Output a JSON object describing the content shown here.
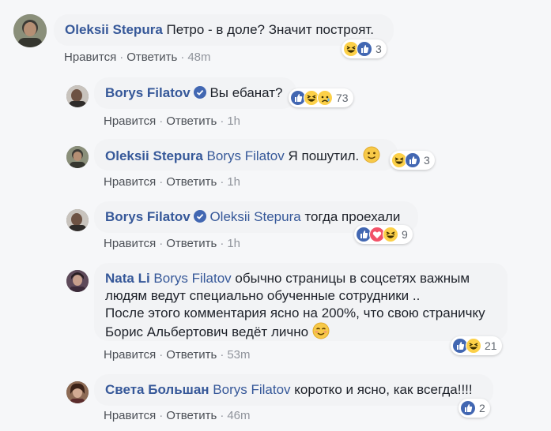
{
  "actions": {
    "like": "Нравится",
    "reply": "Ответить",
    "separator": "·"
  },
  "comments": [
    {
      "author": "Oleksii Stepura",
      "text": "Петро - в доле? Значит построят.",
      "time": "48m",
      "reactions": [
        "haha",
        "like"
      ],
      "count": "3"
    },
    {
      "author": "Borys Filatov",
      "verified": true,
      "text": "Вы ебанат?",
      "time": "1h",
      "reactions": [
        "like",
        "haha",
        "sad"
      ],
      "count": "73"
    },
    {
      "author": "Oleksii Stepura",
      "mention": "Borys Filatov",
      "text": "Я пошутил.",
      "emoji": "smile-emoji",
      "time": "1h",
      "reactions": [
        "haha",
        "like"
      ],
      "count": "3"
    },
    {
      "author": "Borys Filatov",
      "verified": true,
      "mention": "Oleksii Stepura",
      "text": "тогда проехали",
      "time": "1h",
      "reactions": [
        "like",
        "love",
        "haha"
      ],
      "count": "9"
    },
    {
      "author": "Nata Li",
      "mention": "Borys Filatov",
      "text_line1": "обычно страницы в соцсетях важным",
      "text_line2": "людям ведут специально обученные сотрудники ..",
      "text_line3": "После этого комментария ясно на 200%, что свою страничку",
      "text_line4": "Борис Альбертович ведёт лично",
      "emoji": "blush-emoji",
      "time": "53m",
      "reactions": [
        "like",
        "haha"
      ],
      "count": "21"
    },
    {
      "author": "Света Большан",
      "mention": "Borys Filatov",
      "text": "коротко и ясно, как всегда!!!!",
      "time": "46m",
      "reactions": [
        "like"
      ],
      "count": "2"
    }
  ],
  "colors": {
    "link": "#365899",
    "bubble": "#f2f3f5",
    "like_blue": "#4267b2",
    "love_red": "#f25268",
    "haha_yellow": "#fcd048"
  }
}
